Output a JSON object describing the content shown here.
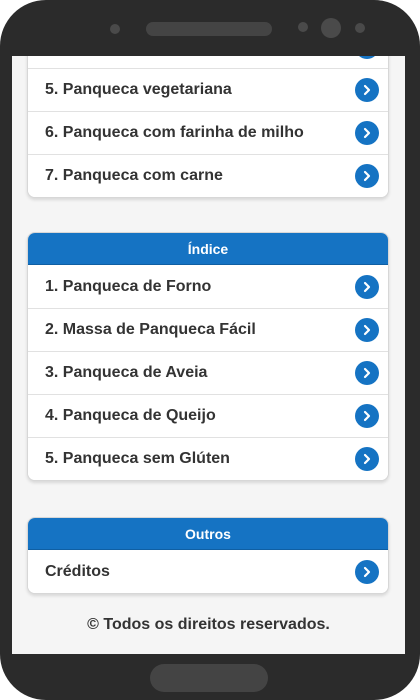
{
  "top_list": {
    "items": [
      {
        "label": "5. Panqueca vegetariana"
      },
      {
        "label": "6. Panqueca com farinha de milho"
      },
      {
        "label": "7. Panqueca com carne"
      }
    ]
  },
  "index_section": {
    "title": "Índice",
    "items": [
      {
        "label": "1. Panqueca de Forno"
      },
      {
        "label": "2. Massa de Panqueca Fácil"
      },
      {
        "label": "3. Panqueca de Aveia"
      },
      {
        "label": "4. Panqueca de Queijo"
      },
      {
        "label": "5. Panqueca sem Glúten"
      }
    ]
  },
  "other_section": {
    "title": "Outros",
    "items": [
      {
        "label": "Créditos"
      }
    ]
  },
  "footer": {
    "text": "© Todos os direitos reservados."
  },
  "icons": {
    "row_action": "chevron-right-circle-icon"
  },
  "colors": {
    "accent": "#1573c3",
    "header_text": "#ffffff",
    "item_text": "#333333"
  }
}
